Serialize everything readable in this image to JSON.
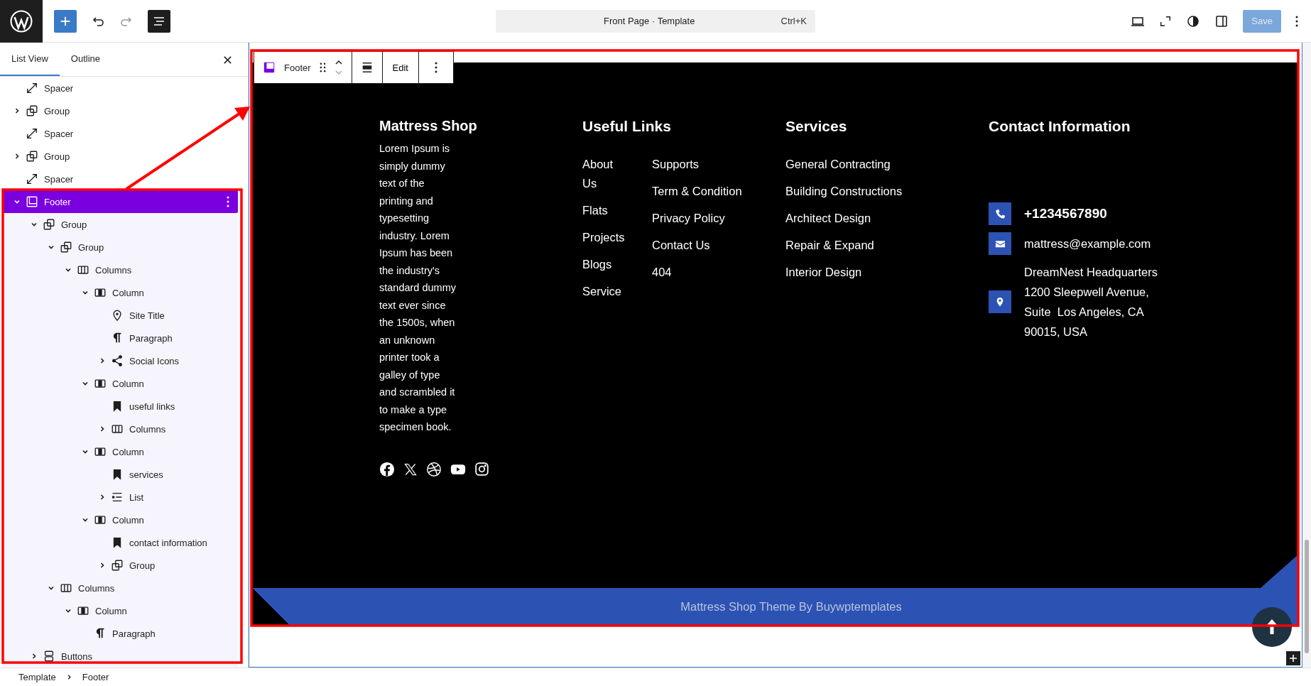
{
  "topbar": {
    "title": "Front Page · Template",
    "shortcut": "Ctrl+K",
    "save": {
      "label": "Save",
      "disabled": true
    },
    "redo_disabled": true,
    "list_view_selected": true
  },
  "sidebar": {
    "tabs": [
      {
        "label": "List View",
        "selected": true
      },
      {
        "label": "Outline",
        "selected": false
      }
    ],
    "tree": [
      {
        "kind": "spacer",
        "label": "Spacer",
        "expandable": false,
        "expanded": false,
        "selected": false
      },
      {
        "kind": "group",
        "label": "Group",
        "expandable": true,
        "expanded": false,
        "selected": false
      },
      {
        "kind": "spacer",
        "label": "Spacer",
        "expandable": false,
        "expanded": false,
        "selected": false
      },
      {
        "kind": "group",
        "label": "Group",
        "expandable": true,
        "expanded": false,
        "selected": false
      },
      {
        "kind": "spacer",
        "label": "Spacer",
        "expandable": false,
        "expanded": false,
        "selected": false
      },
      {
        "kind": "footer",
        "label": "Footer",
        "expandable": true,
        "expanded": true,
        "selected": true,
        "children": [
          {
            "kind": "group",
            "label": "Group",
            "expandable": true,
            "expanded": true,
            "selected": false,
            "children": [
              {
                "kind": "group",
                "label": "Group",
                "expandable": true,
                "expanded": true,
                "selected": false,
                "children": [
                  {
                    "kind": "columns",
                    "label": "Columns",
                    "expandable": true,
                    "expanded": true,
                    "selected": false,
                    "children": [
                      {
                        "kind": "column",
                        "label": "Column",
                        "expandable": true,
                        "expanded": true,
                        "selected": false,
                        "children": [
                          {
                            "kind": "site-title",
                            "label": "Site Title",
                            "expandable": false,
                            "expanded": false,
                            "selected": false
                          },
                          {
                            "kind": "paragraph",
                            "label": "Paragraph",
                            "expandable": false,
                            "expanded": false,
                            "selected": false
                          },
                          {
                            "kind": "share",
                            "label": "Social Icons",
                            "expandable": true,
                            "expanded": false,
                            "selected": false
                          }
                        ]
                      },
                      {
                        "kind": "column",
                        "label": "Column",
                        "expandable": true,
                        "expanded": true,
                        "selected": false,
                        "children": [
                          {
                            "kind": "bookmark",
                            "label": "useful links",
                            "expandable": false,
                            "expanded": false,
                            "selected": false
                          },
                          {
                            "kind": "columns",
                            "label": "Columns",
                            "expandable": true,
                            "expanded": false,
                            "selected": false
                          }
                        ]
                      },
                      {
                        "kind": "column",
                        "label": "Column",
                        "expandable": true,
                        "expanded": true,
                        "selected": false,
                        "children": [
                          {
                            "kind": "bookmark",
                            "label": "services",
                            "expandable": false,
                            "expanded": false,
                            "selected": false
                          },
                          {
                            "kind": "list",
                            "label": "List",
                            "expandable": true,
                            "expanded": false,
                            "selected": false
                          }
                        ]
                      },
                      {
                        "kind": "column",
                        "label": "Column",
                        "expandable": true,
                        "expanded": true,
                        "selected": false,
                        "children": [
                          {
                            "kind": "bookmark",
                            "label": "contact information",
                            "expandable": false,
                            "expanded": false,
                            "selected": false
                          },
                          {
                            "kind": "group",
                            "label": "Group",
                            "expandable": true,
                            "expanded": false,
                            "selected": false
                          }
                        ]
                      }
                    ]
                  }
                ]
              },
              {
                "kind": "columns",
                "label": "Columns",
                "expandable": true,
                "expanded": true,
                "selected": false,
                "children": [
                  {
                    "kind": "column",
                    "label": "Column",
                    "expandable": true,
                    "expanded": true,
                    "selected": false,
                    "children": [
                      {
                        "kind": "paragraph",
                        "label": "Paragraph",
                        "expandable": false,
                        "expanded": false,
                        "selected": false
                      }
                    ]
                  }
                ]
              }
            ]
          },
          {
            "kind": "buttons",
            "label": "Buttons",
            "expandable": true,
            "expanded": false,
            "selected": false
          }
        ]
      }
    ]
  },
  "block_toolbar": {
    "block": "Footer",
    "edit": "Edit"
  },
  "footer": {
    "brand": {
      "title": "Mattress Shop",
      "text": "Lorem Ipsum is simply dummy text of the printing and typesetting industry. Lorem Ipsum has been the industry's standard dummy text ever since the 1500s, when an unknown printer took a galley of type and scrambled it to make a type specimen book.",
      "social": [
        {
          "kind": "facebook"
        },
        {
          "kind": "x"
        },
        {
          "kind": "dribbble"
        },
        {
          "kind": "youtube"
        },
        {
          "kind": "instagram"
        }
      ]
    },
    "useful_links": {
      "title": "Useful Links",
      "columns": [
        [
          "About Us",
          "Flats",
          "Projects",
          "Blogs",
          "Service"
        ],
        [
          "Supports",
          "Term & Condition",
          "Privacy Policy",
          "Contact Us",
          "404"
        ]
      ]
    },
    "services": {
      "title": "Services",
      "items": [
        "General Contracting",
        "Building Constructions",
        "Architect Design",
        "Repair & Expand",
        "Interior Design"
      ]
    },
    "contact": {
      "title": "Contact Information",
      "items": [
        {
          "kind": "phone",
          "text": "+1234567890"
        },
        {
          "kind": "email",
          "text": "mattress@example.com"
        },
        {
          "kind": "address",
          "text": "DreamNest Headquarters\n1200 Sleepwell Avenue,\nSuite  Los Angeles, CA\n90015, USA"
        }
      ]
    },
    "copyright": "Mattress Shop Theme By Buywptemplates"
  },
  "breadcrumb": [
    "Template",
    "Footer"
  ]
}
